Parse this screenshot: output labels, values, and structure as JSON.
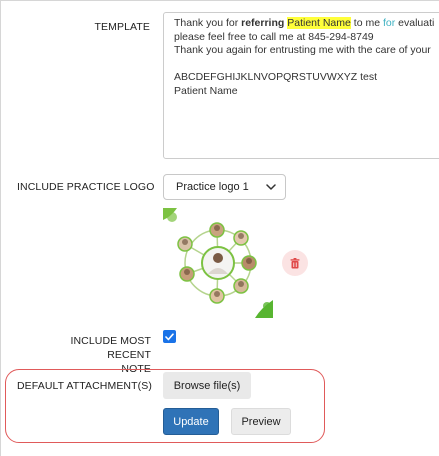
{
  "template": {
    "label": "TEMPLATE",
    "line1_pre": "Thank you for ",
    "line1_bold": "referring",
    "line1_space": " ",
    "line1_highlight": "Patient Name",
    "line1_mid": " to me ",
    "line1_teal": "for",
    "line1_post": " evaluati",
    "line2": "please feel free to call me at 845-294-8749",
    "line3": "Thank you again for entrusting me with the care of your",
    "line5": "ABCDEFGHIJKLNVOPQRSTUVWXYZ test",
    "line6": "Patient Name"
  },
  "logo": {
    "label": "INCLUDE PRACTICE LOGO",
    "selected": "Practice logo 1"
  },
  "recent_note": {
    "label_line1": "INCLUDE MOST RECENT",
    "label_line2": "NOTE",
    "checked": true
  },
  "attachment": {
    "label": "DEFAULT ATTACHMENT(S)",
    "browse_label": "Browse file(s)"
  },
  "actions": {
    "update_label": "Update",
    "preview_label": "Preview"
  },
  "colors": {
    "primary": "#2f73b7",
    "highlight": "#ffff3a",
    "annotation_ring": "#e05a5a",
    "checkbox": "#1a73e8"
  }
}
